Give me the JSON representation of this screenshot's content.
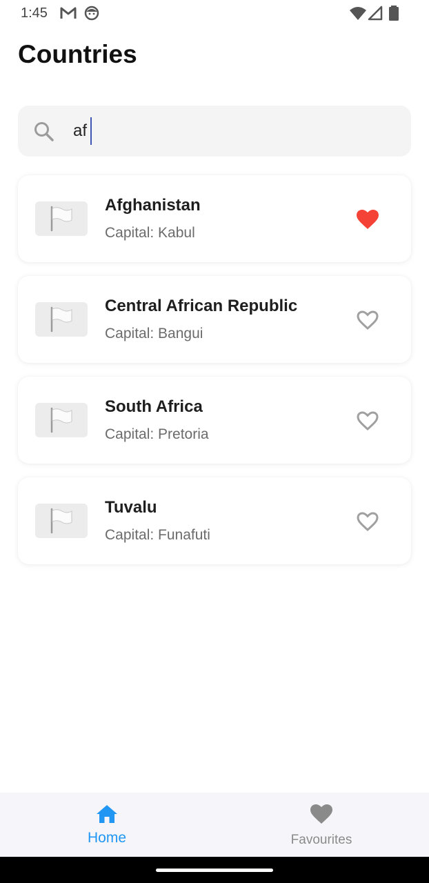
{
  "status_bar": {
    "time": "1:45",
    "icons": [
      "gmail-icon",
      "face-icon",
      "wifi-icon",
      "signal-icon",
      "battery-icon"
    ]
  },
  "page": {
    "title": "Countries"
  },
  "search": {
    "value": "af",
    "placeholder": ""
  },
  "countries": [
    {
      "name": "Afghanistan",
      "capital": "Capital: Kabul",
      "favourite": true
    },
    {
      "name": "Central African Republic",
      "capital": "Capital: Bangui",
      "favourite": false
    },
    {
      "name": "South Africa",
      "capital": "Capital: Pretoria",
      "favourite": false
    },
    {
      "name": "Tuvalu",
      "capital": "Capital: Funafuti",
      "favourite": false
    }
  ],
  "bottom_nav": {
    "items": [
      {
        "label": "Home",
        "icon": "home-icon",
        "active": true
      },
      {
        "label": "Favourites",
        "icon": "heart-icon",
        "active": false
      }
    ]
  },
  "colors": {
    "accent": "#2196f3",
    "favourite_active": "#f44336",
    "favourite_inactive": "#a0a0a0",
    "nav_inactive": "#8a8a8a"
  }
}
